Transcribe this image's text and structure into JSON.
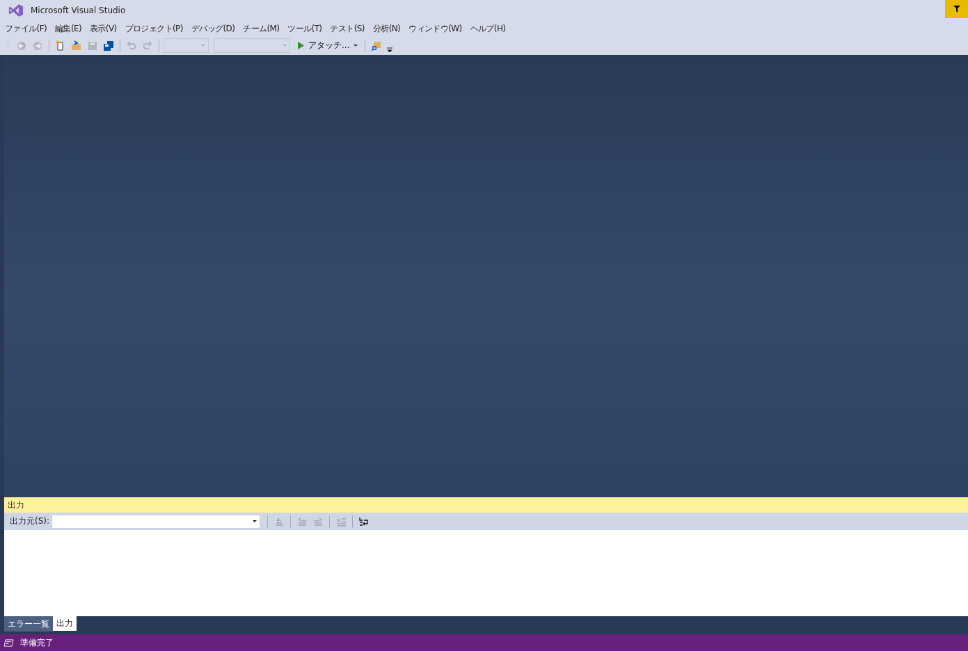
{
  "window": {
    "title": "Microsoft Visual Studio"
  },
  "menu": [
    "ファイル(F)",
    "編集(E)",
    "表示(V)",
    "プロジェクト(P)",
    "デバッグ(D)",
    "チーム(M)",
    "ツール(T)",
    "テスト(S)",
    "分析(N)",
    "ウィンドウ(W)",
    "ヘルプ(H)"
  ],
  "toolbar": [
    {
      "kind": "back",
      "disabled": true
    },
    {
      "kind": "forward",
      "disabled": true
    },
    {
      "kind": "sep"
    },
    {
      "kind": "new",
      "disabled": false
    },
    {
      "kind": "open",
      "disabled": false
    },
    {
      "kind": "save",
      "disabled": true
    },
    {
      "kind": "saveall",
      "disabled": false
    },
    {
      "kind": "sep"
    },
    {
      "kind": "undo",
      "disabled": true
    },
    {
      "kind": "redo",
      "disabled": true
    },
    {
      "kind": "sep"
    },
    {
      "kind": "combo"
    },
    {
      "kind": "combo"
    },
    {
      "kind": "run",
      "label": "アタッチ..."
    },
    {
      "kind": "sep"
    },
    {
      "kind": "find",
      "disabled": false
    }
  ],
  "output": {
    "title": "出力",
    "source_label": "出力元(S):",
    "tools": [
      {
        "kind": "sep"
      },
      {
        "kind": "goto",
        "disabled": true
      },
      {
        "kind": "sep"
      },
      {
        "kind": "prev",
        "disabled": true
      },
      {
        "kind": "next",
        "disabled": true
      },
      {
        "kind": "sep"
      },
      {
        "kind": "clear",
        "disabled": true
      },
      {
        "kind": "sep"
      },
      {
        "kind": "wrap",
        "disabled": false
      }
    ]
  },
  "bottom_tabs": [
    {
      "label": "エラー一覧",
      "selected": false
    },
    {
      "label": "出力",
      "selected": true
    }
  ],
  "status_bar": {
    "text": "準備完了"
  }
}
